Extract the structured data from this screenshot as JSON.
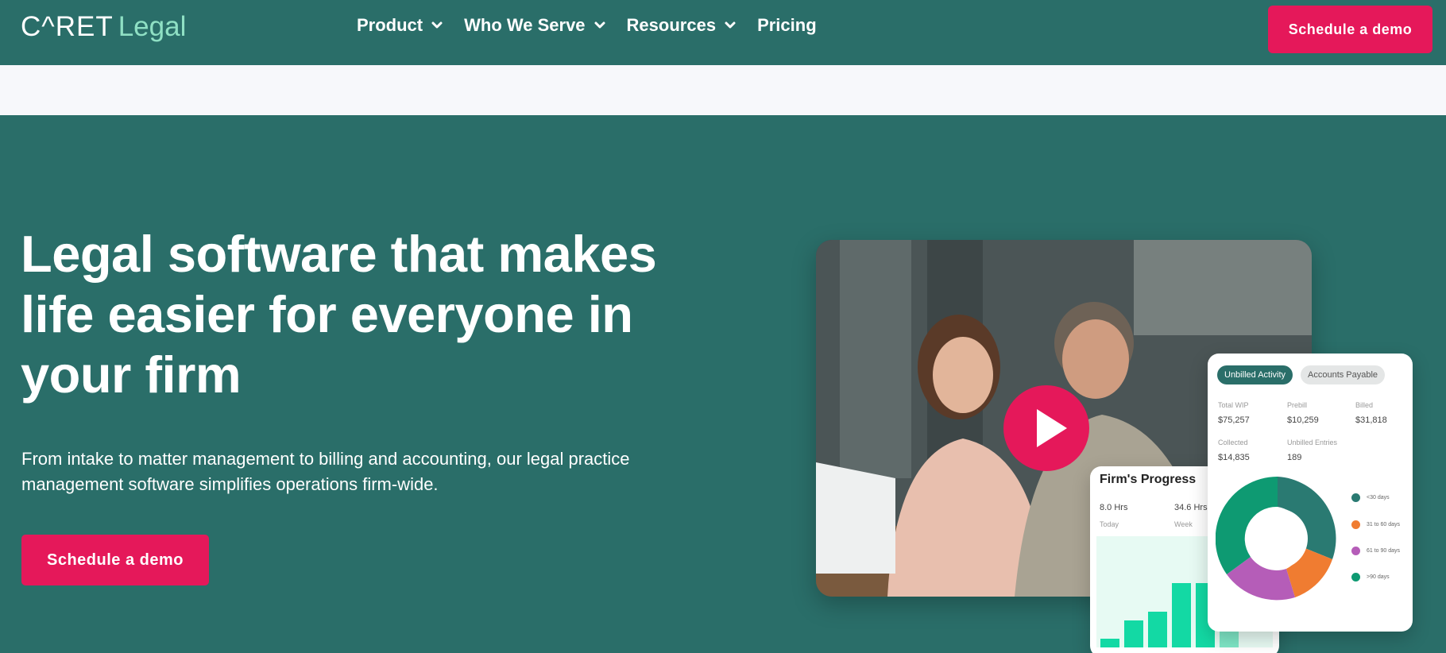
{
  "nav": {
    "logo_caret": "C^RET",
    "logo_legal": "Legal",
    "menu": [
      {
        "label": "Product",
        "has_dropdown": true
      },
      {
        "label": "Who We Serve",
        "has_dropdown": true
      },
      {
        "label": "Resources",
        "has_dropdown": true
      },
      {
        "label": "Pricing",
        "has_dropdown": false
      }
    ],
    "cta_label": "Schedule a demo"
  },
  "hero": {
    "headline": "Legal software that makes life easier for everyone in your firm",
    "subtext": "From intake to matter management to billing and accounting, our legal practice management software simplifies operations firm-wide.",
    "cta_label": "Schedule a demo",
    "video_play_icon": "play-icon"
  },
  "progress_card": {
    "title": "Firm's Progress",
    "today_value": "8.0 Hrs",
    "today_label": "Today",
    "week_value": "34.6 Hrs",
    "week_label": "Week",
    "bars": [
      0.08,
      0.24,
      0.32,
      0.58,
      0.58,
      0.15
    ]
  },
  "activity_card": {
    "tabs": [
      "Unbilled Activity",
      "Accounts Payable"
    ],
    "stats": [
      {
        "label": "Total WIP",
        "value": "$75,257"
      },
      {
        "label": "Prebill",
        "value": "$10,259"
      },
      {
        "label": "Billed",
        "value": "$31,818"
      },
      {
        "label": "Collected",
        "value": "$14,835"
      },
      {
        "label": "Unbilled Entries",
        "value": "189"
      }
    ],
    "legend": [
      {
        "label": "<30 days",
        "color": "#2a7a72"
      },
      {
        "label": "31 to 60 days",
        "color": "#f07c31"
      },
      {
        "label": "61 to 90 days",
        "color": "#b55db8"
      },
      {
        "label": ">90 days",
        "color": "#0e9a72"
      }
    ]
  },
  "colors": {
    "brand_teal": "#2a6e69",
    "accent_pink": "#e5185a",
    "logo_mint": "#8fe0c4"
  }
}
